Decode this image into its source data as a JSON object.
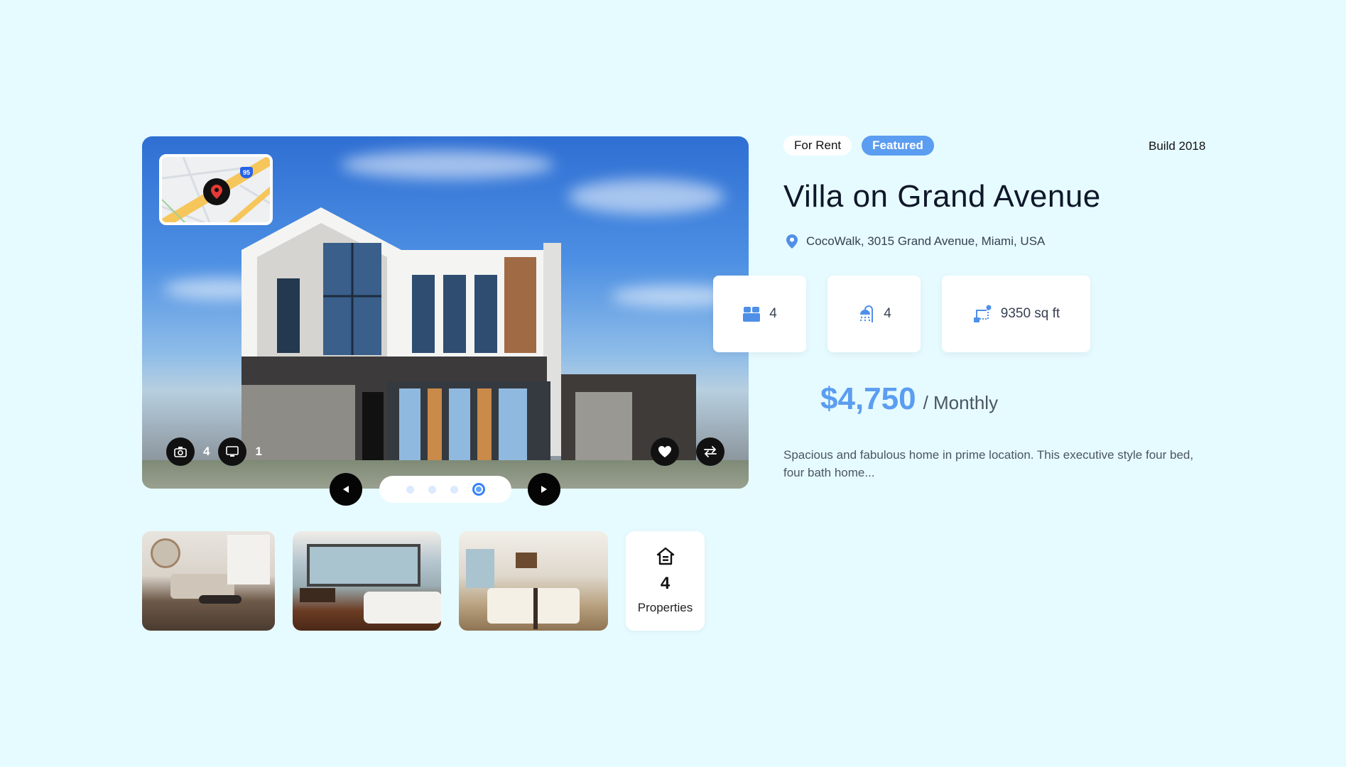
{
  "listing": {
    "tags": {
      "rent": "For Rent",
      "featured": "Featured"
    },
    "build": "Build 2018",
    "title": "Villa on Grand Avenue",
    "address": "CocoWalk, 3015 Grand Avenue, Miami, USA",
    "stats": {
      "beds": "4",
      "baths": "4",
      "area": "9350 sq ft"
    },
    "price": {
      "amount": "$4,750",
      "period": "/ Monthly"
    },
    "description": "Spacious and fabulous home in prime location. This executive style four bed, four bath home..."
  },
  "hero": {
    "photo_count": "4",
    "video_count": "1",
    "map_highway": "95",
    "slides": [
      {
        "active": false
      },
      {
        "active": false
      },
      {
        "active": false
      },
      {
        "active": true
      }
    ]
  },
  "gallery": {
    "thumbnails": [
      {
        "name": "living-room"
      },
      {
        "name": "bedroom"
      },
      {
        "name": "dining-room"
      }
    ],
    "properties": {
      "count": "4",
      "label": "Properties"
    }
  },
  "colors": {
    "background": "#e6fbff",
    "accent": "#5b9df0",
    "dark_button": "#050505"
  }
}
